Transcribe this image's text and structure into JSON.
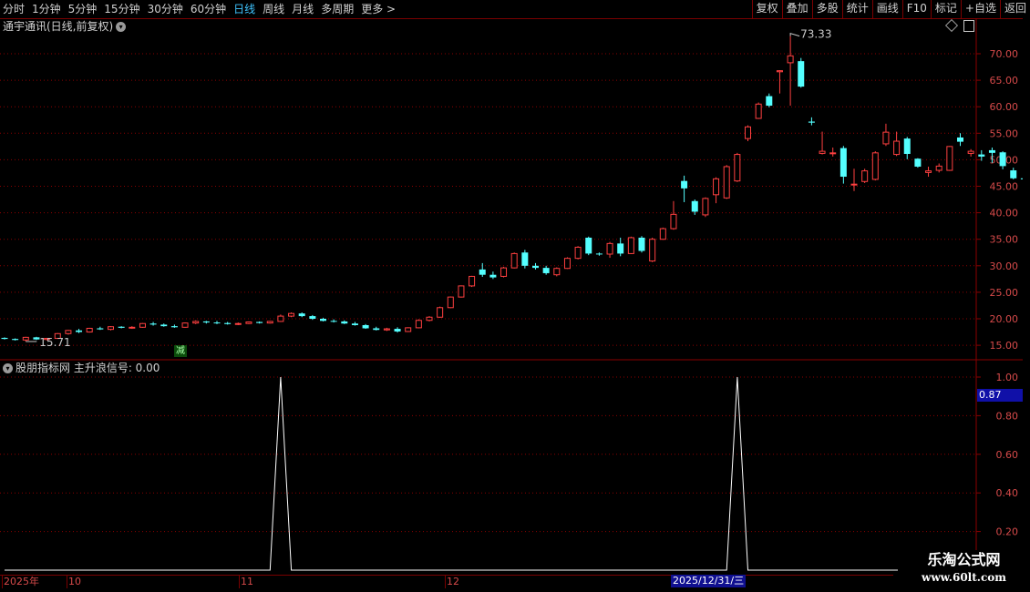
{
  "toolbar": {
    "periods": [
      "分时",
      "1分钟",
      "5分钟",
      "15分钟",
      "30分钟",
      "60分钟",
      "日线",
      "周线",
      "月线",
      "多周期",
      "更多 >"
    ],
    "active_period": "日线",
    "tools": [
      "复权",
      "叠加",
      "多股",
      "统计",
      "画线",
      "F10",
      "标记",
      "+自选",
      "返回"
    ]
  },
  "main_panel": {
    "title": "通宇通讯(日线,前复权)",
    "dropdown_glyph": "▾",
    "high_label": "73.33",
    "low_label": "15.71",
    "signal_badge": "减",
    "y_ticks": [
      "70.00",
      "65.00",
      "60.00",
      "55.00",
      "50.00",
      "45.00",
      "40.00",
      "35.00",
      "30.00",
      "25.00",
      "20.00",
      "15.00"
    ]
  },
  "sub_panel": {
    "title": "股朋指标网  主升浪信号: 0.00",
    "dropdown_glyph": "▾",
    "y_ticks": [
      "1.00",
      "0.80",
      "0.60",
      "0.40",
      "0.20"
    ],
    "current_value": "0.87"
  },
  "date_axis": {
    "labels": [
      "2025年",
      "10",
      "11",
      "12"
    ],
    "cursor_label": "2025/12/31/三"
  },
  "watermark": {
    "line1": "乐淘公式网",
    "line2": "www.60lt.com"
  },
  "colors": {
    "up": "#ff4040",
    "down": "#54ffff",
    "grid": "#8b0000",
    "axis_text": "#d64a4a",
    "signal_line": "#ffffff"
  },
  "chart_data": {
    "type": "candlestick",
    "ylim": [
      15,
      73.33
    ],
    "candles": [
      [
        16.4,
        16.5,
        16.1,
        16.2
      ],
      [
        16.2,
        16.3,
        15.9,
        16.0
      ],
      [
        16.0,
        16.6,
        15.71,
        16.5
      ],
      [
        16.5,
        16.6,
        16.0,
        16.1
      ],
      [
        16.1,
        16.4,
        15.9,
        16.3
      ],
      [
        16.3,
        17.3,
        16.2,
        17.2
      ],
      [
        17.2,
        17.9,
        17.0,
        17.8
      ],
      [
        17.8,
        18.1,
        17.3,
        17.5
      ],
      [
        17.5,
        18.3,
        17.4,
        18.2
      ],
      [
        18.2,
        18.5,
        17.9,
        18.0
      ],
      [
        18.0,
        18.6,
        17.8,
        18.5
      ],
      [
        18.5,
        18.6,
        18.2,
        18.3
      ],
      [
        18.3,
        18.6,
        18.1,
        18.4
      ],
      [
        18.4,
        19.2,
        18.3,
        19.1
      ],
      [
        19.1,
        19.4,
        18.7,
        18.9
      ],
      [
        18.9,
        19.1,
        18.5,
        18.6
      ],
      [
        18.6,
        18.9,
        18.3,
        18.4
      ],
      [
        18.4,
        19.3,
        18.3,
        19.2
      ],
      [
        19.2,
        19.7,
        19.0,
        19.5
      ],
      [
        19.5,
        19.6,
        19.1,
        19.3
      ],
      [
        19.3,
        19.6,
        19.0,
        19.2
      ],
      [
        19.2,
        19.4,
        18.9,
        19.0
      ],
      [
        19.0,
        19.3,
        18.8,
        19.1
      ],
      [
        19.1,
        19.5,
        19.0,
        19.4
      ],
      [
        19.4,
        19.5,
        19.1,
        19.2
      ],
      [
        19.2,
        19.6,
        19.1,
        19.5
      ],
      [
        19.5,
        20.8,
        19.4,
        20.5
      ],
      [
        20.5,
        21.2,
        20.3,
        21.0
      ],
      [
        21.0,
        21.2,
        20.3,
        20.5
      ],
      [
        20.5,
        20.7,
        19.8,
        20.0
      ],
      [
        20.0,
        20.2,
        19.5,
        19.6
      ],
      [
        19.6,
        19.9,
        19.3,
        19.5
      ],
      [
        19.5,
        19.7,
        19.0,
        19.1
      ],
      [
        19.1,
        19.4,
        18.7,
        18.8
      ],
      [
        18.8,
        19.0,
        18.1,
        18.2
      ],
      [
        18.2,
        18.5,
        17.8,
        17.9
      ],
      [
        17.9,
        18.3,
        17.7,
        18.1
      ],
      [
        18.1,
        18.4,
        17.4,
        17.6
      ],
      [
        17.6,
        18.4,
        17.5,
        18.3
      ],
      [
        18.3,
        19.9,
        18.2,
        19.7
      ],
      [
        19.7,
        20.5,
        19.5,
        20.3
      ],
      [
        20.3,
        22.3,
        20.2,
        22.1
      ],
      [
        22.1,
        24.2,
        22.0,
        24.1
      ],
      [
        24.1,
        26.3,
        24.0,
        26.2
      ],
      [
        26.2,
        28.1,
        26.0,
        28.0
      ],
      [
        29.3,
        30.5,
        27.9,
        28.3
      ],
      [
        28.3,
        28.9,
        27.5,
        27.8
      ],
      [
        28.0,
        29.8,
        27.8,
        29.6
      ],
      [
        29.6,
        32.5,
        29.5,
        32.3
      ],
      [
        32.5,
        33.0,
        29.5,
        30.0
      ],
      [
        30.0,
        30.5,
        29.3,
        29.6
      ],
      [
        29.6,
        30.0,
        28.3,
        28.6
      ],
      [
        28.3,
        29.7,
        28.0,
        29.5
      ],
      [
        29.5,
        31.6,
        29.4,
        31.4
      ],
      [
        31.4,
        33.7,
        31.2,
        33.5
      ],
      [
        35.3,
        35.5,
        32.0,
        32.3
      ],
      [
        32.3,
        32.5,
        31.9,
        32.2
      ],
      [
        32.2,
        34.5,
        31.5,
        34.2
      ],
      [
        34.2,
        35.3,
        31.8,
        32.3
      ],
      [
        32.3,
        35.5,
        32.2,
        35.3
      ],
      [
        35.3,
        35.6,
        32.5,
        32.8
      ],
      [
        30.9,
        35.3,
        30.7,
        35.0
      ],
      [
        35.0,
        37.2,
        34.9,
        37.0
      ],
      [
        37.0,
        42.2,
        36.8,
        39.7
      ],
      [
        46.0,
        47.0,
        42.0,
        44.6
      ],
      [
        42.2,
        42.5,
        39.6,
        40.2
      ],
      [
        39.6,
        42.9,
        39.2,
        42.7
      ],
      [
        43.4,
        46.7,
        41.8,
        46.4
      ],
      [
        42.8,
        49.0,
        42.6,
        48.7
      ],
      [
        46.0,
        51.3,
        45.8,
        51.0
      ],
      [
        54.0,
        56.5,
        53.5,
        56.2
      ],
      [
        57.8,
        60.8,
        57.7,
        60.5
      ],
      [
        62.0,
        62.5,
        59.9,
        60.2
      ],
      [
        66.6,
        66.9,
        62.5,
        66.8
      ],
      [
        68.3,
        73.33,
        60.2,
        69.6
      ],
      [
        68.6,
        69.2,
        63.6,
        63.8
      ],
      [
        57.2,
        58.0,
        56.5,
        57.0
      ],
      [
        51.2,
        55.3,
        51.0,
        51.6
      ],
      [
        51.3,
        52.3,
        50.6,
        51.3
      ],
      [
        52.2,
        52.6,
        45.5,
        46.8
      ],
      [
        45.4,
        48.3,
        44.1,
        45.4
      ],
      [
        45.9,
        48.3,
        45.6,
        47.9
      ],
      [
        46.3,
        51.6,
        46.1,
        51.3
      ],
      [
        53.0,
        56.8,
        52.6,
        55.2
      ],
      [
        51.0,
        55.3,
        50.7,
        53.5
      ],
      [
        54.0,
        54.3,
        50.1,
        51.1
      ],
      [
        50.2,
        50.3,
        48.5,
        48.7
      ],
      [
        47.6,
        48.7,
        46.8,
        47.9
      ],
      [
        48.0,
        49.3,
        47.6,
        48.8
      ],
      [
        48.0,
        52.6,
        47.9,
        52.5
      ],
      [
        54.2,
        55.0,
        52.6,
        53.4
      ],
      [
        51.2,
        52.0,
        50.6,
        51.6
      ],
      [
        51.0,
        51.8,
        49.8,
        50.6
      ],
      [
        51.8,
        52.3,
        49.4,
        51.3
      ],
      [
        51.4,
        51.6,
        48.2,
        48.8
      ],
      [
        48.0,
        48.5,
        46.3,
        46.5
      ],
      [
        46.5,
        47.8,
        45.9,
        46.3
      ]
    ],
    "signal": {
      "name": "主升浪信号",
      "ylim": [
        0,
        1
      ],
      "length": 96,
      "peaks_at": [
        26,
        69
      ],
      "peak_value": 1
    }
  }
}
